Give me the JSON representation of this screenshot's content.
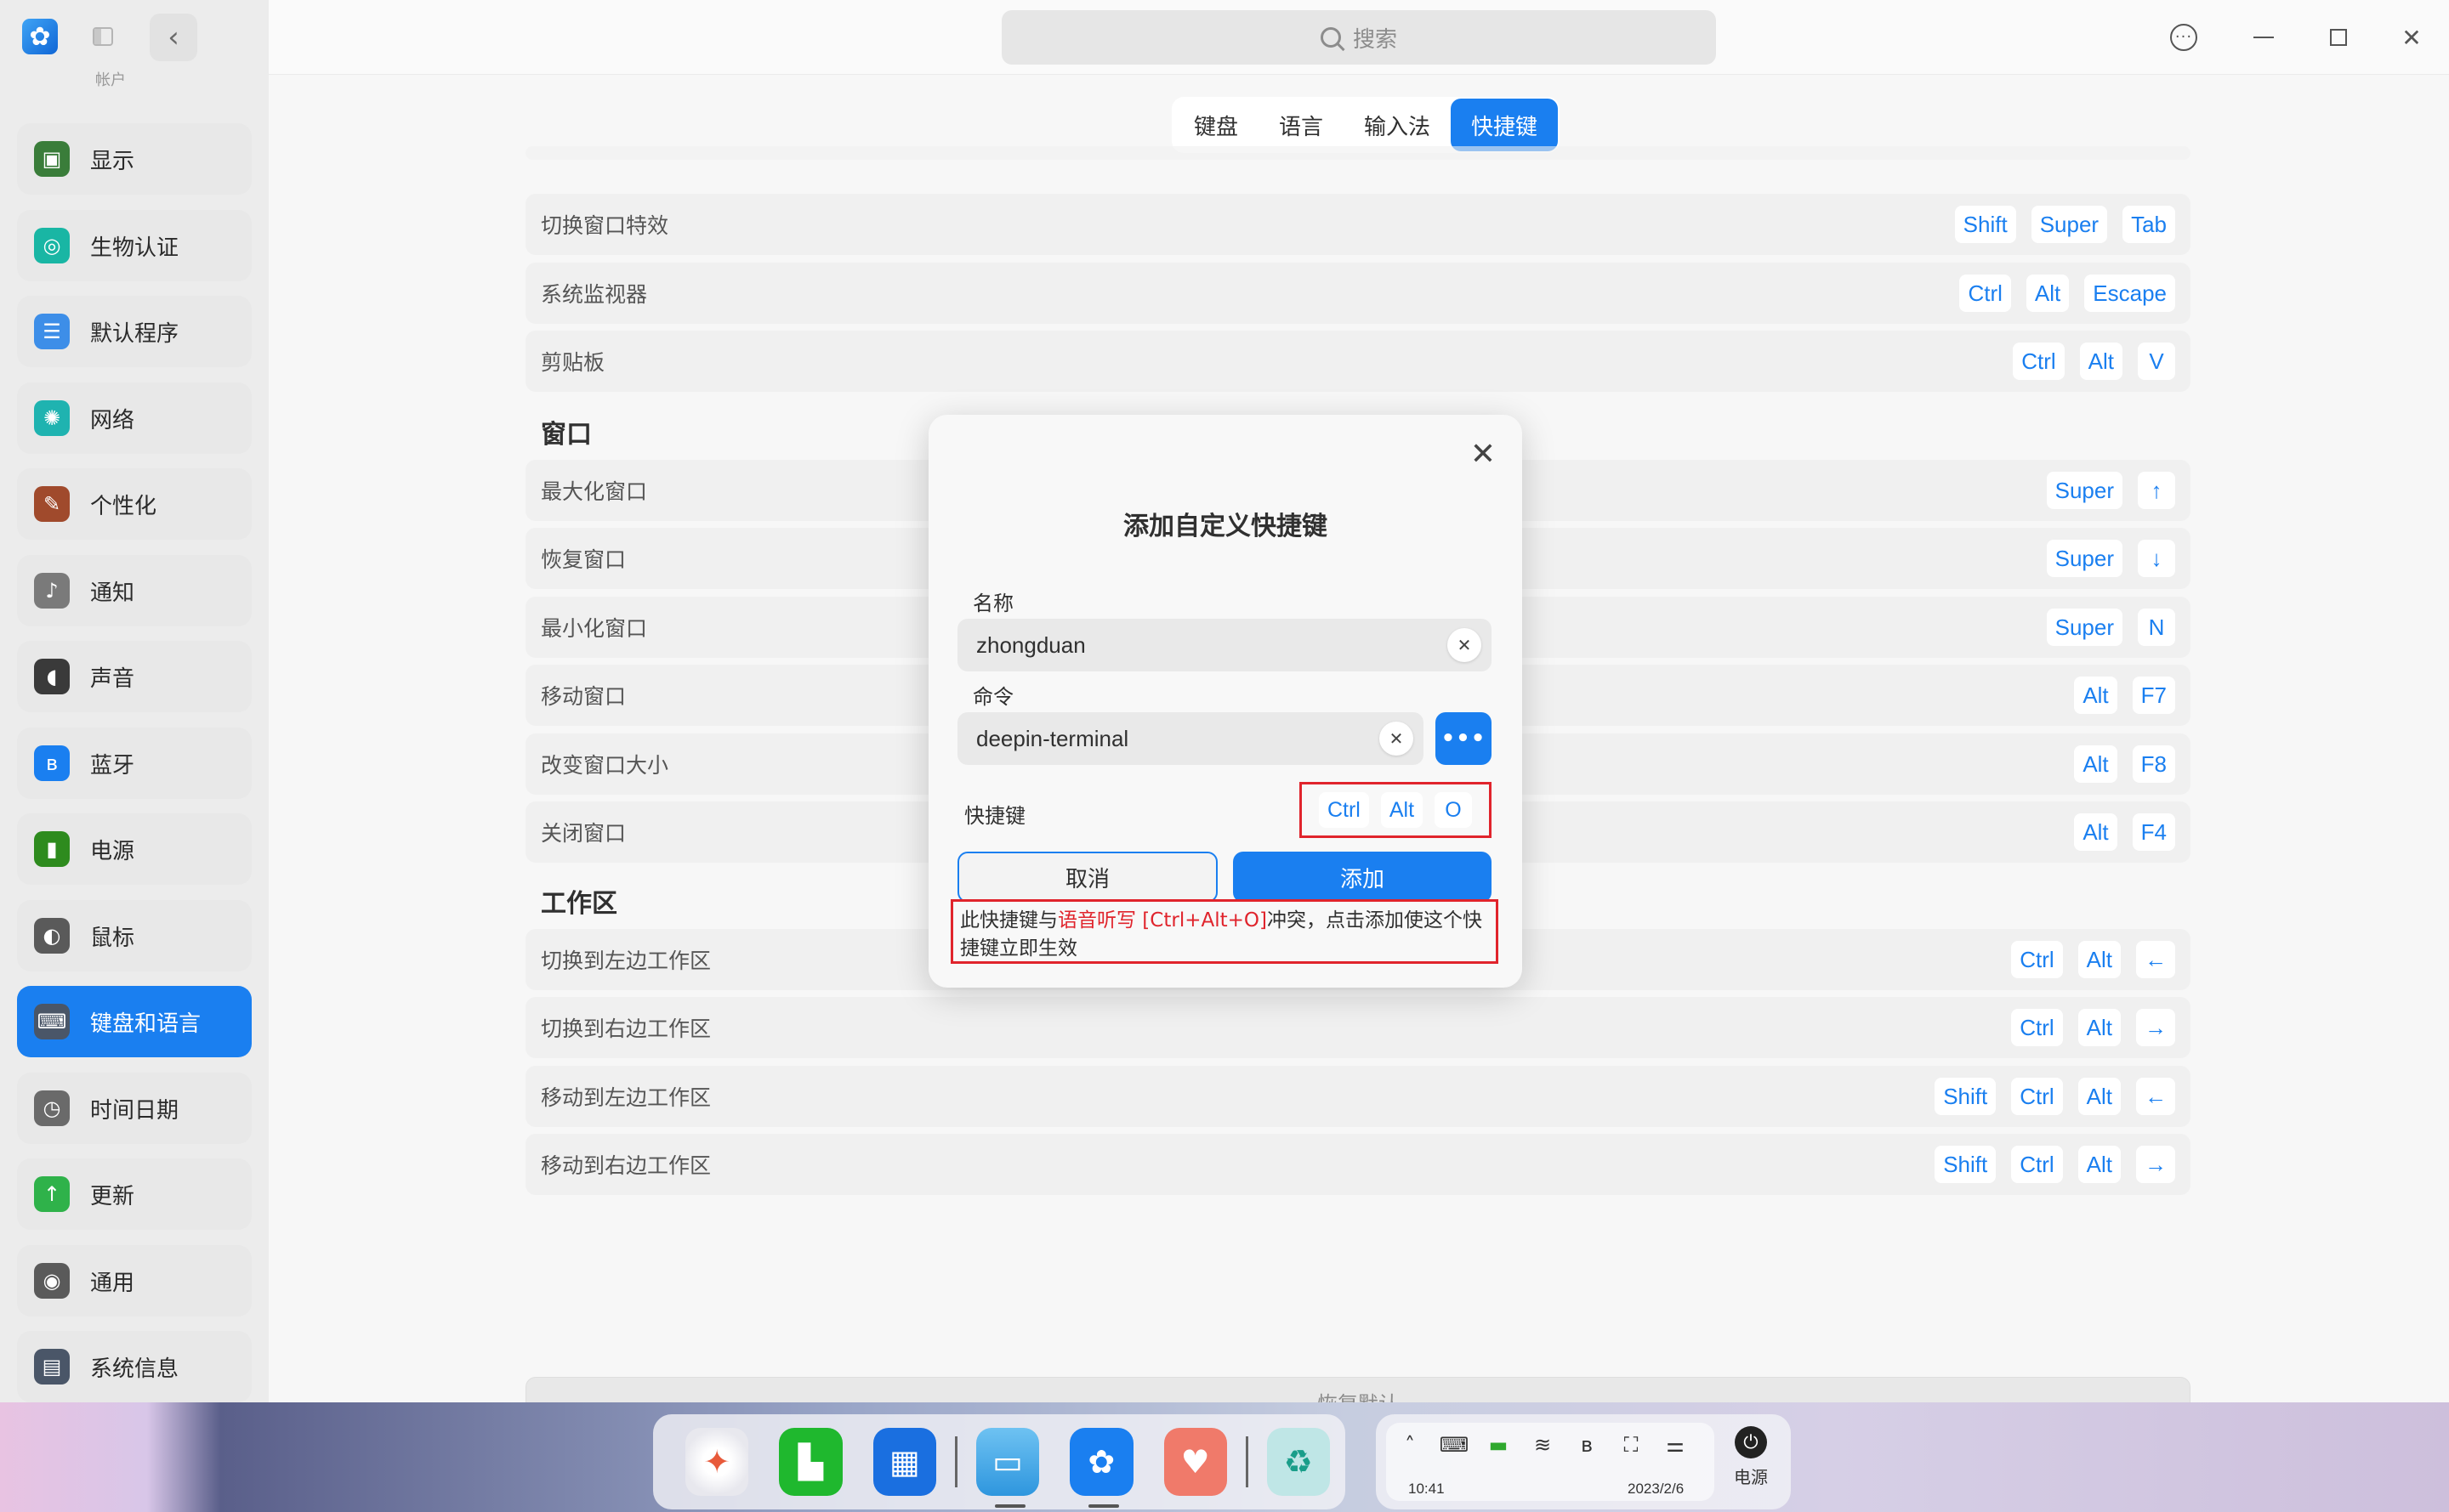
{
  "sidebar": {
    "partial_label": "帐户",
    "items": [
      {
        "label": "显示",
        "icon": "monitor-icon",
        "color": "#3a7d3a",
        "glyph": "▣"
      },
      {
        "label": "生物认证",
        "icon": "fingerprint-icon",
        "color": "#19b6a4",
        "glyph": "◎"
      },
      {
        "label": "默认程序",
        "icon": "default-apps-icon",
        "color": "#3d8ee8",
        "glyph": "☰"
      },
      {
        "label": "网络",
        "icon": "network-globe-icon",
        "color": "#1fb3b0",
        "glyph": "✺"
      },
      {
        "label": "个性化",
        "icon": "personalization-icon",
        "color": "#a04a2c",
        "glyph": "✎"
      },
      {
        "label": "通知",
        "icon": "bell-icon",
        "color": "#7a7a7a",
        "glyph": "♪"
      },
      {
        "label": "声音",
        "icon": "speaker-icon",
        "color": "#3a3a3a",
        "glyph": "◖"
      },
      {
        "label": "蓝牙",
        "icon": "bluetooth-icon",
        "color": "#1a7ff0",
        "glyph": "ʙ"
      },
      {
        "label": "电源",
        "icon": "battery-icon",
        "color": "#2e8b1e",
        "glyph": "▮"
      },
      {
        "label": "鼠标",
        "icon": "mouse-icon",
        "color": "#5a5a5a",
        "glyph": "◐"
      },
      {
        "label": "键盘和语言",
        "icon": "keyboard-icon",
        "color": "#4a5668",
        "glyph": "⌨",
        "active": true
      },
      {
        "label": "时间日期",
        "icon": "clock-icon",
        "color": "#6a6a6a",
        "glyph": "◷"
      },
      {
        "label": "更新",
        "icon": "update-arrow-icon",
        "color": "#2fb24a",
        "glyph": "↑"
      },
      {
        "label": "通用",
        "icon": "general-gear-icon",
        "color": "#5a5a5a",
        "glyph": "◉"
      },
      {
        "label": "系统信息",
        "icon": "system-info-icon",
        "color": "#4a5668",
        "glyph": "▤"
      }
    ]
  },
  "search": {
    "placeholder": "搜索"
  },
  "tabs": [
    {
      "label": "键盘"
    },
    {
      "label": "语言"
    },
    {
      "label": "输入法"
    },
    {
      "label": "快捷键",
      "active": true
    }
  ],
  "shortcuts": {
    "top_rows": [
      {
        "name": "切换窗口特效",
        "keys": [
          "Shift",
          "Super",
          "Tab"
        ]
      },
      {
        "name": "系统监视器",
        "keys": [
          "Ctrl",
          "Alt",
          "Escape"
        ]
      },
      {
        "name": "剪贴板",
        "keys": [
          "Ctrl",
          "Alt",
          "V"
        ]
      }
    ],
    "window_section": "窗口",
    "window_rows": [
      {
        "name": "最大化窗口",
        "keys": [
          "Super",
          "↑"
        ]
      },
      {
        "name": "恢复窗口",
        "keys": [
          "Super",
          "↓"
        ]
      },
      {
        "name": "最小化窗口",
        "keys": [
          "Super",
          "N"
        ]
      },
      {
        "name": "移动窗口",
        "keys": [
          "Alt",
          "F7"
        ]
      },
      {
        "name": "改变窗口大小",
        "keys": [
          "Alt",
          "F8"
        ]
      },
      {
        "name": "关闭窗口",
        "keys": [
          "Alt",
          "F4"
        ]
      }
    ],
    "workspace_section": "工作区",
    "workspace_rows": [
      {
        "name": "切换到左边工作区",
        "keys": [
          "Ctrl",
          "Alt",
          "←"
        ]
      },
      {
        "name": "切换到右边工作区",
        "keys": [
          "Ctrl",
          "Alt",
          "→"
        ]
      },
      {
        "name": "移动到左边工作区",
        "keys": [
          "Shift",
          "Ctrl",
          "Alt",
          "←"
        ]
      },
      {
        "name": "移动到右边工作区",
        "keys": [
          "Shift",
          "Ctrl",
          "Alt",
          "→"
        ]
      }
    ],
    "restore_label": "恢复默认",
    "add_label": "+"
  },
  "dialog": {
    "title": "添加自定义快捷键",
    "name_label": "名称",
    "name_value": "zhongduan",
    "command_label": "命令",
    "command_value": "deepin-terminal",
    "shortcut_label": "快捷键",
    "shortcut_keys": [
      "Ctrl",
      "Alt",
      "O"
    ],
    "cancel_label": "取消",
    "add_label": "添加",
    "conflict_prefix": "此快捷键与",
    "conflict_highlight": "语音听写 [Ctrl+Alt+O]",
    "conflict_suffix": "冲突，点击添加使这个快捷键立即生效"
  },
  "dock": {
    "apps": [
      "launcher-icon",
      "terminal-icon",
      "multitask-icon",
      "file-manager-icon",
      "control-center-icon",
      "app-store-icon",
      "trash-icon"
    ]
  },
  "tray": {
    "time": "10:41",
    "date": "2023/2/6",
    "power_label": "电源"
  },
  "colors": {
    "accent": "#1a7ff0",
    "warning": "#e0242c"
  }
}
